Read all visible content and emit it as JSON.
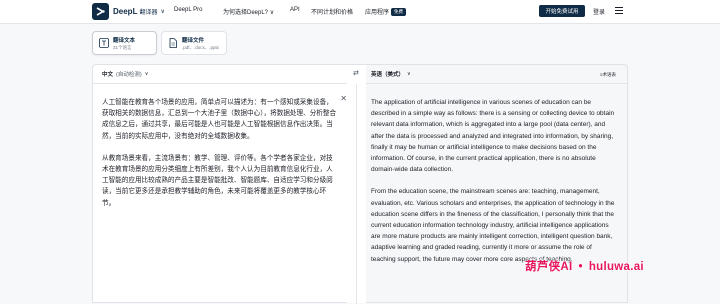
{
  "nav": {
    "brand": "DeepL",
    "brand_sub": "翻译器",
    "items": [
      "DeepL Pro",
      "为何选择DeepL?",
      "API",
      "不同计划和价格",
      "应用程序"
    ],
    "apps_badge": "免费",
    "try_label": "开始免费试用",
    "login_label": "登录"
  },
  "tabs": [
    {
      "title": "翻译文本",
      "sub": "31个语言"
    },
    {
      "title": "翻译文件",
      "sub": ".pdf、.docx、.pptx"
    }
  ],
  "source": {
    "lang": "中文",
    "detect": "(自动检测)",
    "paragraphs": [
      "人工智能在教育各个场景的应用，简单点可以描述为：有一个感知或采集设备，获取相关的数据信息，汇总到一个大池子里（数据中心），将数据处理、分析整合成信息之后，通过共享，最后可能是人也可能是人工智能根据信息作出决策。当然，当前的实际应用中，没有绝对的全域数据收集。",
      "从教育场景来看，主流场景有：教学、管理、评价等。各个学者各家企业，对技术在教育场景的应用分类细度上有所差别，我个人认为目前教育信息化行业，人工智能的应用比较成熟的产品主要是智能批改、智能题库、自适应学习和分级阅读，当前它更多还是承担教学辅助的角色，未来可能将覆盖更多的教学核心环节。"
    ]
  },
  "target": {
    "lang": "英语（美式）",
    "glossary": "术语表",
    "paragraphs": [
      "The application of artificial intelligence in various scenes of education can be described in a simple way as follows: there is a sensing or collecting device to obtain relevant data information, which is aggregated into a large pool (data center), and after the data is processed and analyzed and integrated into information, by sharing, finally it may be human or artificial intelligence to make decisions based on the information. Of course, in the current practical application, there is no absolute domain-wide data collection.",
      "From the education scene, the mainstream scenes are: teaching, management, evaluation, etc. Various scholars and enterprises, the application of technology in the education scene differs in the fineness of the classification, I personally think that the current education information technology industry, artificial intelligence applications are more mature products are mainly intelligent correction, intelligent question bank, adaptive learning and graded reading, currently it more or assume the role of teaching support, the future may cover more core aspects of teaching."
    ]
  },
  "watermark": {
    "left": "葫芦侠AI",
    "right": "huluwa.ai"
  }
}
